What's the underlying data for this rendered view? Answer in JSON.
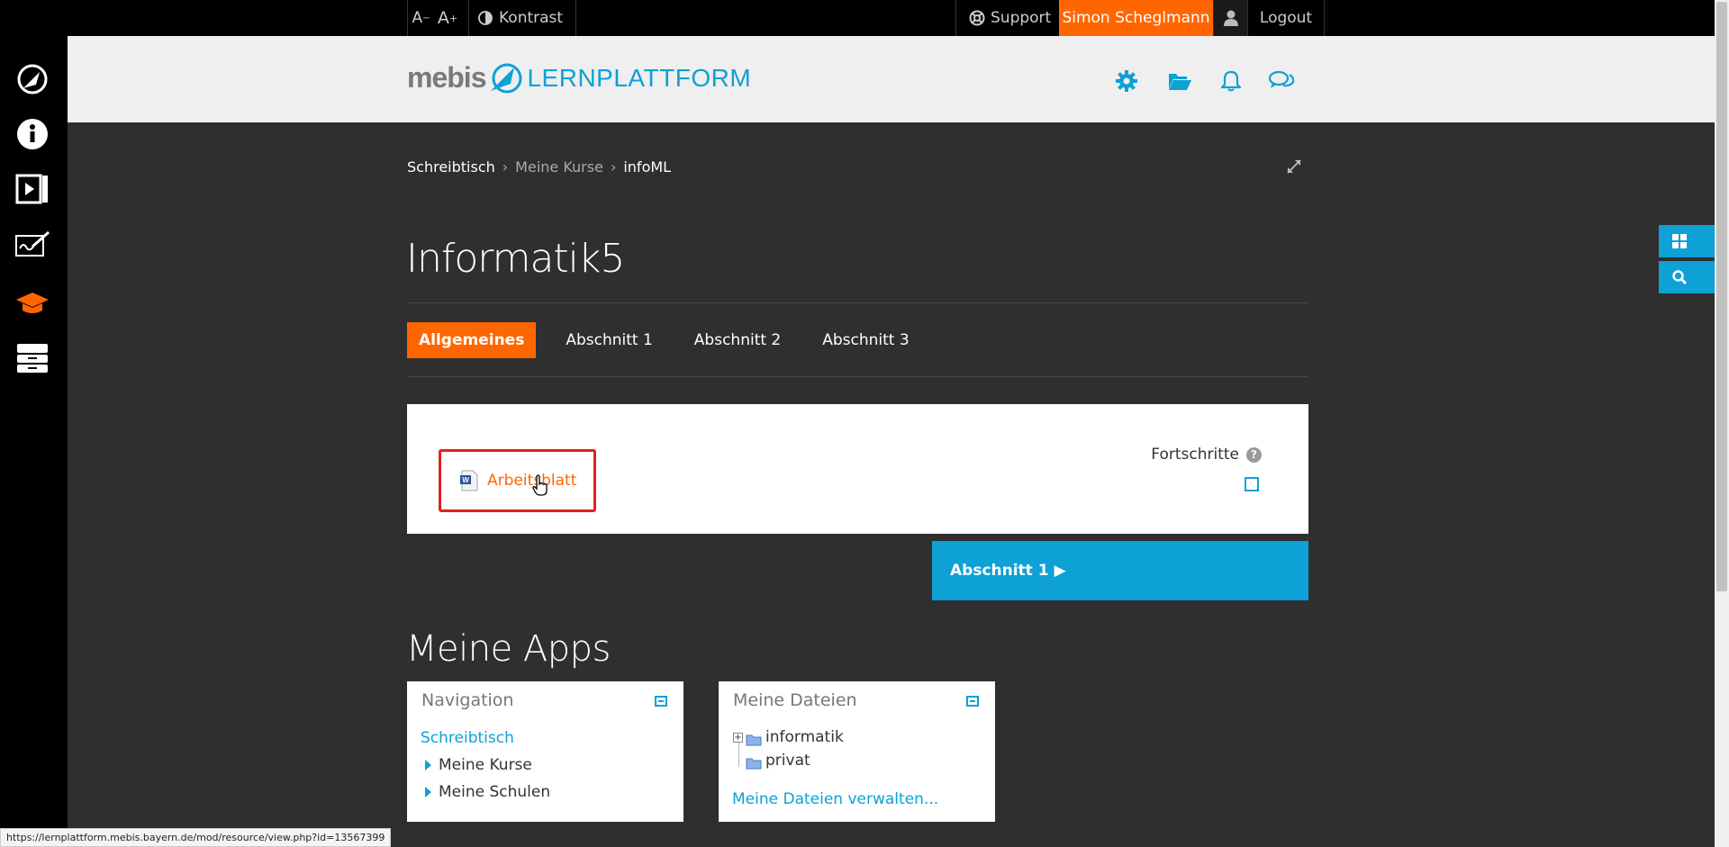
{
  "topbar": {
    "font_decrease": "A",
    "font_increase": "A",
    "contrast": "Kontrast",
    "support": "Support",
    "user_name": "Simon Scheglmann",
    "logout": "Logout"
  },
  "header": {
    "logo_mebis": "mebis",
    "logo_lern": "LERNPLATTFORM"
  },
  "breadcrumb": {
    "items": [
      "Schreibtisch",
      "Meine Kurse",
      "infoML"
    ],
    "separator": "›"
  },
  "course": {
    "title": "Informatik5",
    "tabs": [
      "Allgemeines",
      "Abschnitt 1",
      "Abschnitt 2",
      "Abschnitt 3"
    ],
    "active_tab": "Allgemeines"
  },
  "section": {
    "activity_label": "Arbeitsblatt",
    "progress_label": "Fortschritte",
    "help": "?",
    "next_section": "Abschnitt 1 ▶"
  },
  "apps": {
    "title": "Meine Apps",
    "navigation": {
      "title": "Navigation",
      "home": "Schreibtisch",
      "items": [
        "Meine Kurse",
        "Meine Schulen"
      ]
    },
    "files": {
      "title": "Meine Dateien",
      "folders": [
        "informatik",
        "privat"
      ],
      "manage": "Meine Dateien verwalten..."
    }
  },
  "status_url": "https://lernplattform.mebis.bayern.de/mod/resource/view.php?id=13567399",
  "colors": {
    "accent_orange": "#ff6600",
    "accent_blue": "#0da1d6",
    "background": "#2f2f2f"
  }
}
